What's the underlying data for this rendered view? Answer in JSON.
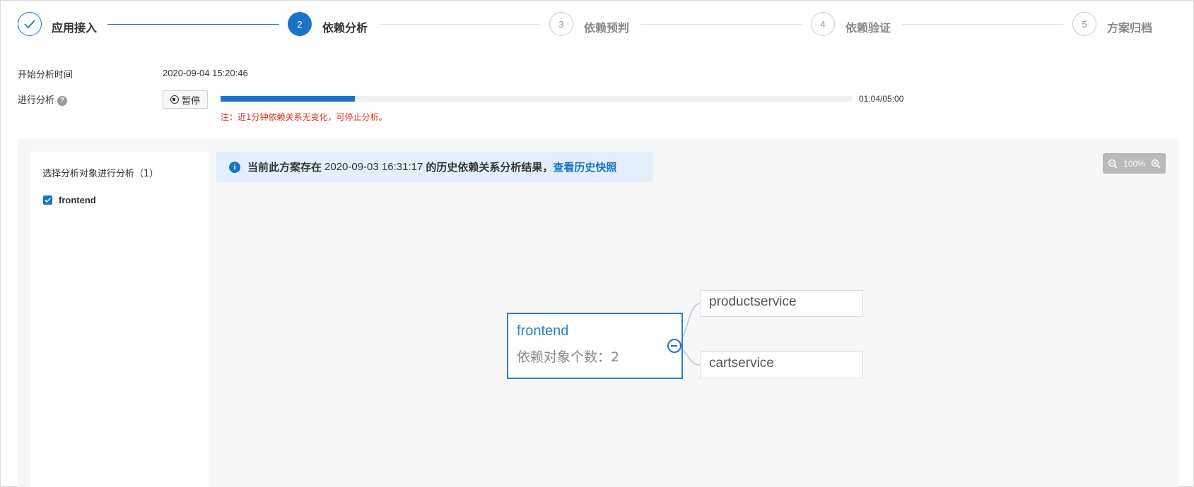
{
  "steps": [
    {
      "index": "",
      "label": "应用接入",
      "state": "done"
    },
    {
      "index": "2",
      "label": "依赖分析",
      "state": "active"
    },
    {
      "index": "3",
      "label": "依赖预判",
      "state": "todo"
    },
    {
      "index": "4",
      "label": "依赖验证",
      "state": "todo"
    },
    {
      "index": "5",
      "label": "方案归档",
      "state": "todo"
    }
  ],
  "analysis": {
    "start_time_label": "开始分析时间",
    "start_time_value": "2020-09-04 15:20:46",
    "progress_label": "进行分析",
    "help_icon": "question-icon",
    "pause_label": "暂停",
    "progress_fraction": 0.213,
    "progress_time": "01:04/05:00",
    "note": "注：近1分钟依赖关系无变化，可停止分析。"
  },
  "sidebar": {
    "title": "选择分析对象进行分析（1）",
    "items": [
      {
        "label": "frontend",
        "checked": true
      }
    ]
  },
  "banner": {
    "prefix": "当前此方案存在",
    "time": "2020-09-03 16:31:17",
    "suffix": "的历史依赖关系分析结果，",
    "link": "查看历史快照"
  },
  "zoom": {
    "level": "100%"
  },
  "graph": {
    "root": {
      "name": "frontend",
      "count_text": "依赖对象个数：2"
    },
    "children": [
      "productservice",
      "cartservice"
    ]
  },
  "colors": {
    "accent": "#1a73c8",
    "warning": "#d93026",
    "banner_bg": "#e3f0fc"
  }
}
